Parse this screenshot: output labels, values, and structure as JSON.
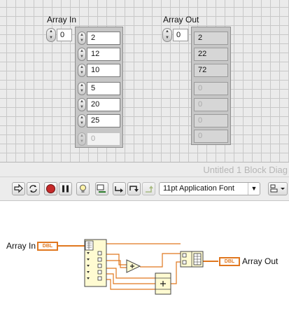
{
  "front_panel": {
    "array_in": {
      "label": "Array In",
      "index": "0",
      "elements": [
        "2",
        "12",
        "10",
        "5",
        "20",
        "25"
      ],
      "empty_element": "0"
    },
    "array_out": {
      "label": "Array Out",
      "index": "0",
      "elements": [
        "2",
        "22",
        "72"
      ],
      "empty_elements": [
        "0",
        "0",
        "0",
        "0"
      ]
    }
  },
  "block_diagram": {
    "window_title": "Untitled 1 Block Diag",
    "toolbar": {
      "font_selector": "11pt Application Font"
    },
    "terminals": {
      "input_label": "Array In",
      "input_type": "DBL",
      "output_label": "Array Out",
      "output_type": "DBL"
    },
    "operators": {
      "add_symbol": "+"
    }
  },
  "colors": {
    "wire_orange": "#e0771f",
    "node_yellow": "#fffbd2",
    "grid_background": "#ebebeb"
  }
}
